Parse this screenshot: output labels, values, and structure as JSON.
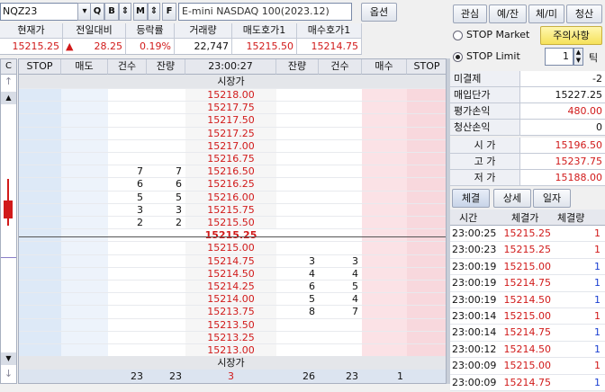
{
  "toolbar": {
    "symbol": "NQZ23",
    "name": "E-mini NASDAQ 100(2023.12)",
    "options_label": "옵션",
    "icons": {
      "search": "Q",
      "b": "B",
      "m": "M",
      "f": "F"
    }
  },
  "tabs": [
    "관심",
    "예/잔",
    "체/미",
    "청산"
  ],
  "quote": {
    "headers": [
      "현재가",
      "전일대비",
      "등락률",
      "거래량",
      "매도호가1",
      "매수호가1"
    ],
    "price": "15215.25",
    "change": "28.25",
    "change_arrow": "▲",
    "rate": "0.19%",
    "volume": "22,747",
    "ask1": "15215.50",
    "bid1": "15214.75"
  },
  "stop": {
    "market_label": "STOP Market",
    "limit_label": "STOP Limit",
    "caution_label": "주의사항",
    "tick_value": "1",
    "tick_unit": "틱"
  },
  "orderbook": {
    "headers": [
      "STOP",
      "매도",
      "건수",
      "잔량",
      "23:00:27",
      "잔량",
      "건수",
      "매수",
      "STOP"
    ],
    "top_label": "시장가",
    "bottom_label": "시장가",
    "rows": [
      {
        "p": "15218.00"
      },
      {
        "p": "15217.75"
      },
      {
        "p": "15217.50"
      },
      {
        "p": "15217.25"
      },
      {
        "p": "15217.00"
      },
      {
        "p": "15216.75"
      },
      {
        "p": "15216.50",
        "ac": "7",
        "aq": "7"
      },
      {
        "p": "15216.25",
        "ac": "6",
        "aq": "6"
      },
      {
        "p": "15216.00",
        "ac": "5",
        "aq": "5"
      },
      {
        "p": "15215.75",
        "ac": "3",
        "aq": "3"
      },
      {
        "p": "15215.50",
        "ac": "2",
        "aq": "2"
      },
      {
        "p": "15215.25",
        "cur": true
      },
      {
        "p": "15215.00"
      },
      {
        "p": "15214.75",
        "bq": "3",
        "bc": "3"
      },
      {
        "p": "15214.50",
        "bq": "4",
        "bc": "4"
      },
      {
        "p": "15214.25",
        "bq": "6",
        "bc": "5"
      },
      {
        "p": "15214.00",
        "bq": "5",
        "bc": "4"
      },
      {
        "p": "15213.75",
        "bq": "8",
        "bc": "7"
      },
      {
        "p": "15213.50"
      },
      {
        "p": "15213.25"
      },
      {
        "p": "15213.00"
      }
    ],
    "totals": {
      "ask_count": "23",
      "ask_qty": "23",
      "diff": "3",
      "bid_qty": "26",
      "bid_count": "23",
      "buy": "1"
    }
  },
  "position": {
    "rows": [
      [
        "미결제",
        "-2"
      ],
      [
        "매입단가",
        "15227.25"
      ],
      [
        "평가손익",
        "480.00"
      ],
      [
        "청산손익",
        "0"
      ]
    ],
    "ohl": [
      [
        "시 가",
        "15196.50"
      ],
      [
        "고 가",
        "15237.75"
      ],
      [
        "저 가",
        "15188.00"
      ]
    ]
  },
  "trade_tabs": [
    "체결",
    "상세",
    "일자"
  ],
  "ticks": {
    "headers": [
      "시간",
      "체결가",
      "체결량"
    ],
    "rows": [
      [
        "23:00:25",
        "15215.25",
        "1",
        "r"
      ],
      [
        "23:00:23",
        "15215.25",
        "1",
        "r"
      ],
      [
        "23:00:19",
        "15215.00",
        "1",
        "b"
      ],
      [
        "23:00:19",
        "15214.75",
        "1",
        "b"
      ],
      [
        "23:00:19",
        "15214.50",
        "1",
        "b"
      ],
      [
        "23:00:14",
        "15215.00",
        "1",
        "r"
      ],
      [
        "23:00:14",
        "15214.75",
        "1",
        "b"
      ],
      [
        "23:00:12",
        "15214.50",
        "1",
        "b"
      ],
      [
        "23:00:09",
        "15215.00",
        "1",
        "r"
      ],
      [
        "23:00:09",
        "15214.75",
        "1",
        "b"
      ]
    ]
  }
}
